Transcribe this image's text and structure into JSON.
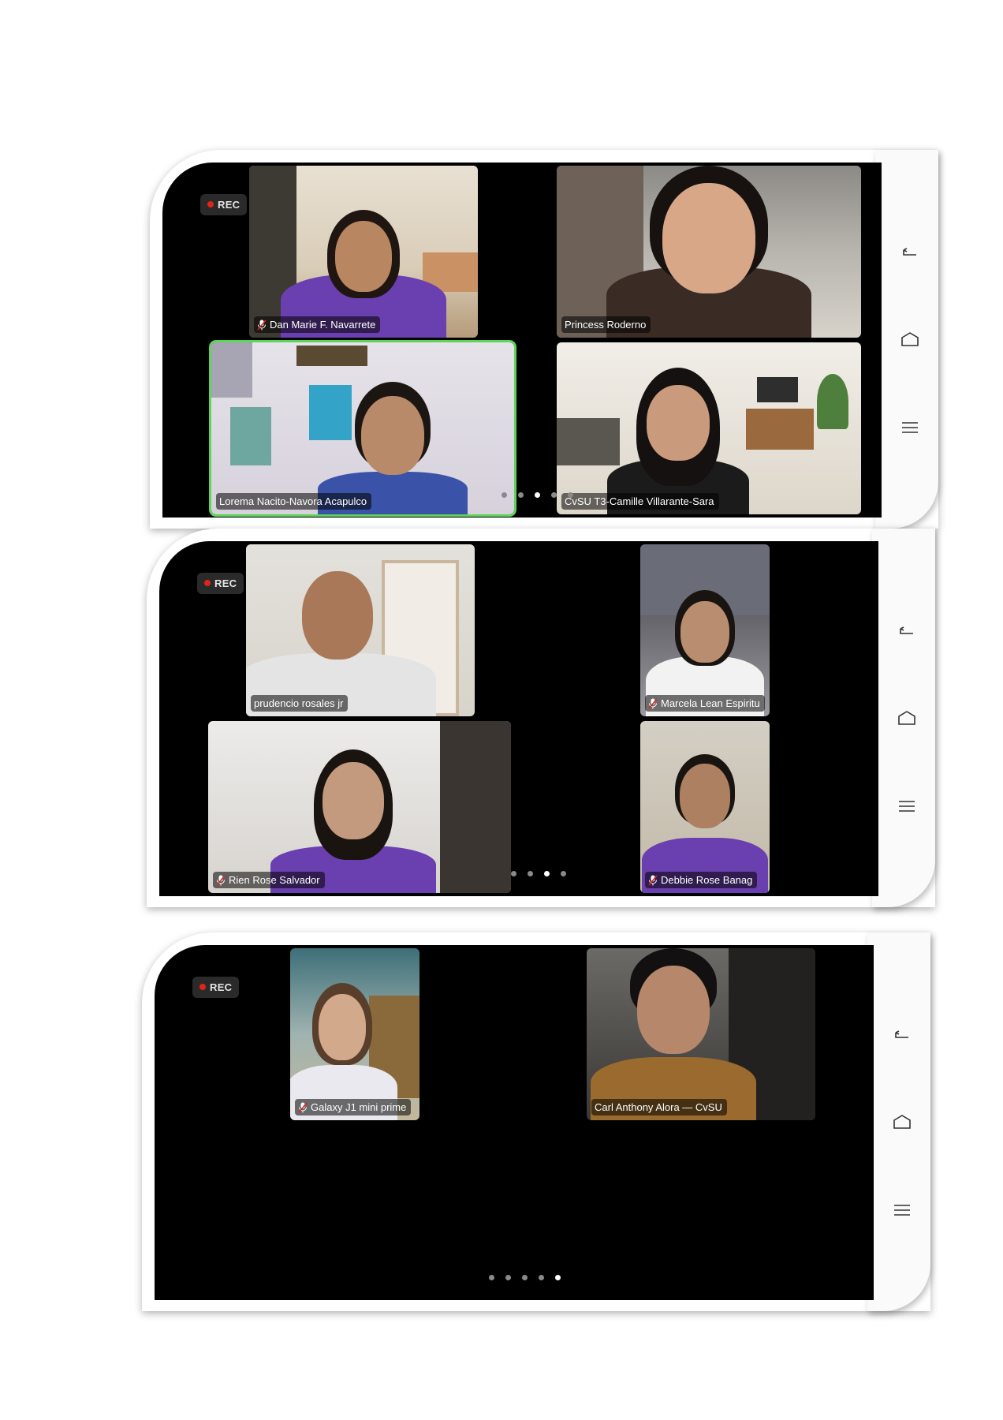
{
  "rec_label": "REC",
  "screens": [
    {
      "participants": [
        {
          "name": "Dan Marie F. Navarrete",
          "muted": true,
          "active": false
        },
        {
          "name": "Princess Roderno",
          "muted": false,
          "active": false
        },
        {
          "name": "Lorema Nacito-Navora Acapulco",
          "muted": false,
          "active": true
        },
        {
          "name": "CvSU T3-Camille Villarante-Sara",
          "muted": false,
          "active": false
        }
      ],
      "pager": {
        "count": 5,
        "current": 3
      }
    },
    {
      "participants": [
        {
          "name": "prudencio rosales jr",
          "muted": false,
          "active": false
        },
        {
          "name": "Marcela Lean Espiritu",
          "muted": true,
          "active": false
        },
        {
          "name": "Rien Rose Salvador",
          "muted": true,
          "active": false
        },
        {
          "name": "Debbie Rose Banag",
          "muted": true,
          "active": false
        }
      ],
      "pager": {
        "count": 4,
        "current": 3
      }
    },
    {
      "participants": [
        {
          "name": "Galaxy J1 mini prime",
          "muted": true,
          "active": false
        },
        {
          "name": "Carl Anthony Alora — CvSU",
          "muted": false,
          "active": false
        }
      ],
      "pager": {
        "count": 5,
        "current": 5
      }
    }
  ],
  "nav_icons": [
    "back-icon",
    "home-icon",
    "recents-menu-icon"
  ],
  "colors": {
    "screen_bg": "#000000",
    "active_speaker_border": "#5fd35a",
    "rec_dot": "#e0241b",
    "uniform_purple": "#6a3fb0"
  }
}
